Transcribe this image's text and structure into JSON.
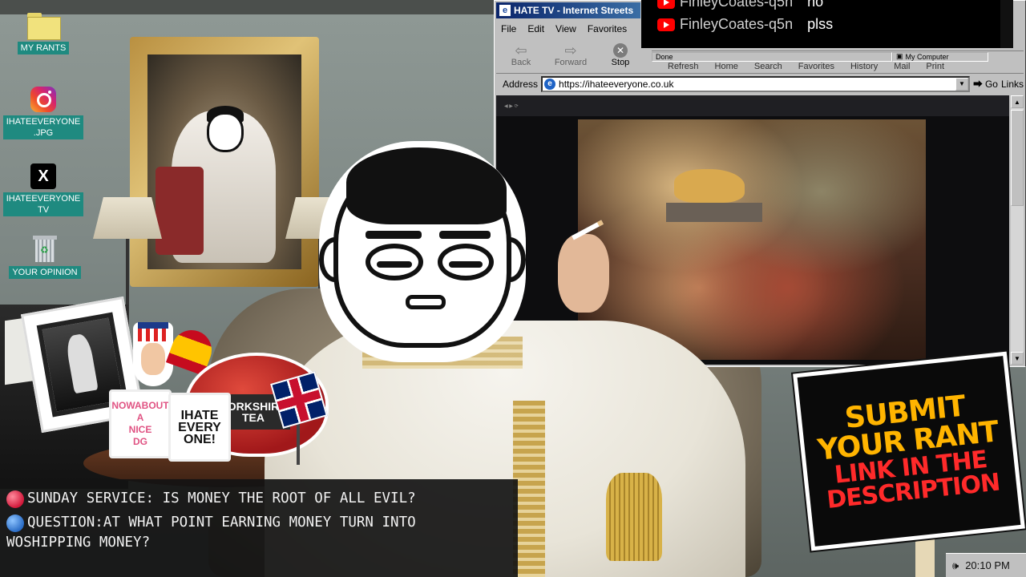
{
  "desktop": {
    "icons": [
      {
        "label": "MY RANTS",
        "icon": "folder-icon"
      },
      {
        "label": "IHATEEVERYONE\n.JPG",
        "icon": "instagram-icon"
      },
      {
        "label": "IHATEEVERYONE\nTV",
        "icon": "x-icon"
      },
      {
        "label": "YOUR OPINION",
        "icon": "recycle-bin-icon"
      }
    ]
  },
  "browser": {
    "title": "HATE TV - Internet Streets",
    "menu": [
      "File",
      "Edit",
      "View",
      "Favorites"
    ],
    "toolbar": {
      "back": "Back",
      "forward": "Forward",
      "stop": "Stop"
    },
    "toolbar_row2": [
      "Refresh",
      "Home",
      "Search",
      "Favorites",
      "History",
      "Mail",
      "Print"
    ],
    "status": {
      "text": "Done",
      "zone": "My Computer"
    },
    "address_label": "Address",
    "url": "https://ihateeveryone.co.uk",
    "go_label": "Go",
    "links_label": "Links"
  },
  "chat": {
    "messages": [
      {
        "user": "FinleyCoates-q5n",
        "text": "no"
      },
      {
        "user": "FinleyCoates-q5n",
        "text": "plss"
      }
    ]
  },
  "props": {
    "mug_left": "NOWABOUT A\nNICE\nDG",
    "mug_right": "IHATE\nEVERY\nONE!",
    "teapot_label": "YORKSHIRE\nTEA"
  },
  "sign": {
    "line1": "SUBMIT",
    "line2": "YOUR RANT",
    "line3": "LINK IN THE",
    "line4": "DESCRIPTION"
  },
  "caption": {
    "line1": "SUNDAY SERVICE: IS MONEY THE ROOT OF ALL EVIL?",
    "line2": "QUESTION:AT WHAT POINT EARNING MONEY TURN INTO",
    "line3": "WOSHIPPING MONEY?"
  },
  "tray": {
    "time": "20:10 PM"
  },
  "colors": {
    "icon_label_bg": "#1f8a80",
    "title_bar": "#0a246a",
    "sign_yellow": "#ffb400",
    "sign_red": "#ff2a2a"
  }
}
